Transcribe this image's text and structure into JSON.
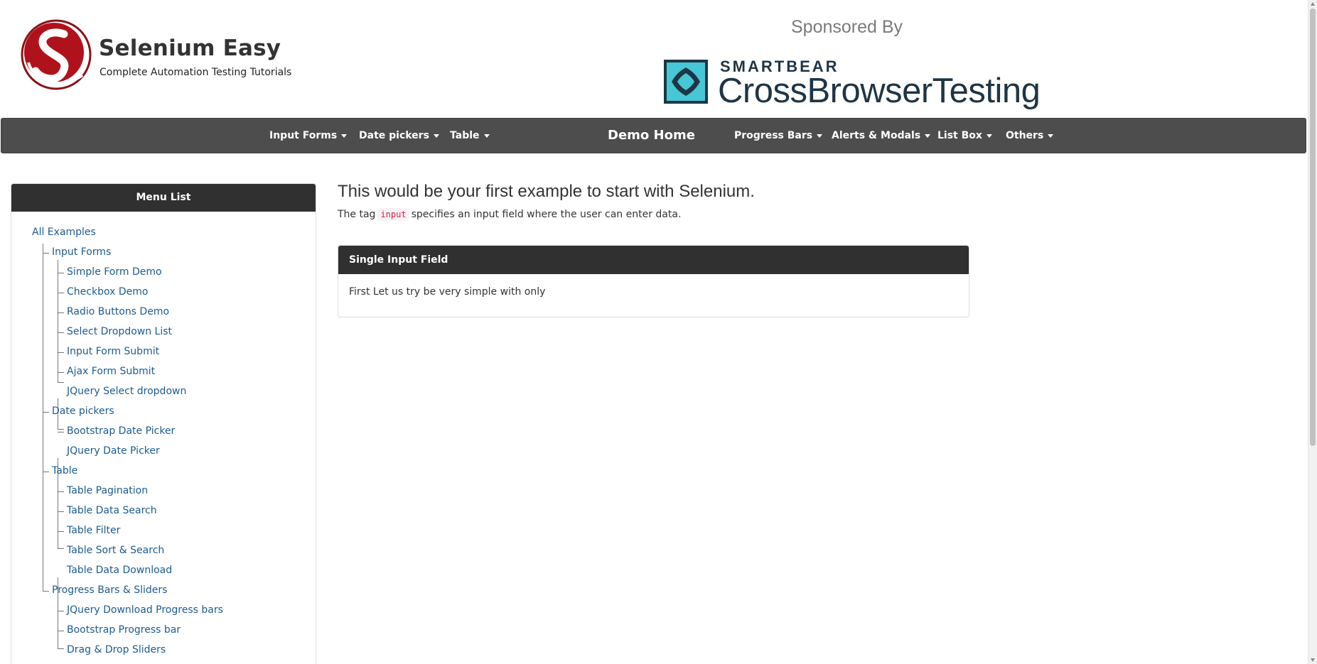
{
  "header": {
    "brand_title": "Selenium Easy",
    "brand_tagline": "Complete Automation Testing Tutorials",
    "logo_icon": "selenium-easy-logo",
    "sponsored_label": "Sponsored By",
    "sponsor": {
      "brand_small": "SMARTBEAR",
      "brand_large": "CrossBrowserTesting",
      "icon": "smartbear-cbt-logo"
    }
  },
  "navbar": {
    "items": [
      {
        "label": "Input Forms",
        "dropdown": true
      },
      {
        "label": "Date pickers",
        "dropdown": true
      },
      {
        "label": "Table",
        "dropdown": true
      },
      {
        "label": "Demo Home",
        "dropdown": false
      },
      {
        "label": "Progress Bars",
        "dropdown": true
      },
      {
        "label": "Alerts & Modals",
        "dropdown": true
      },
      {
        "label": "List Box",
        "dropdown": true
      },
      {
        "label": "Others",
        "dropdown": true
      }
    ]
  },
  "sidebar": {
    "heading": "Menu List",
    "root": "All Examples",
    "groups": [
      {
        "label": "Input Forms",
        "items": [
          "Simple Form Demo",
          "Checkbox Demo",
          "Radio Buttons Demo",
          "Select Dropdown List",
          "Input Form Submit",
          "Ajax Form Submit",
          "JQuery Select dropdown"
        ]
      },
      {
        "label": "Date pickers",
        "items": [
          "Bootstrap Date Picker",
          "JQuery Date Picker"
        ]
      },
      {
        "label": "Table",
        "items": [
          "Table Pagination",
          "Table Data Search",
          "Table Filter",
          "Table Sort & Search",
          "Table Data Download"
        ]
      },
      {
        "label": "Progress Bars & Sliders",
        "items": [
          "JQuery Download Progress bars",
          "Bootstrap Progress bar",
          "Drag & Drop Sliders"
        ]
      }
    ]
  },
  "main": {
    "heading": "This would be your first example to start with Selenium.",
    "desc_prefix": "The tag",
    "desc_code": "input",
    "desc_suffix": "specifies an input field where the user can enter data.",
    "panel": {
      "heading": "Single Input Field",
      "body": "First Let us try be very simple with only"
    }
  },
  "colors": {
    "navbar_bg": "#4d4d4d",
    "heading_bg": "#303030",
    "link": "#1c5b91",
    "logo_red": "#b0121b",
    "sponsor_teal": "#47c7d6",
    "sponsor_navy": "#1f3545"
  }
}
